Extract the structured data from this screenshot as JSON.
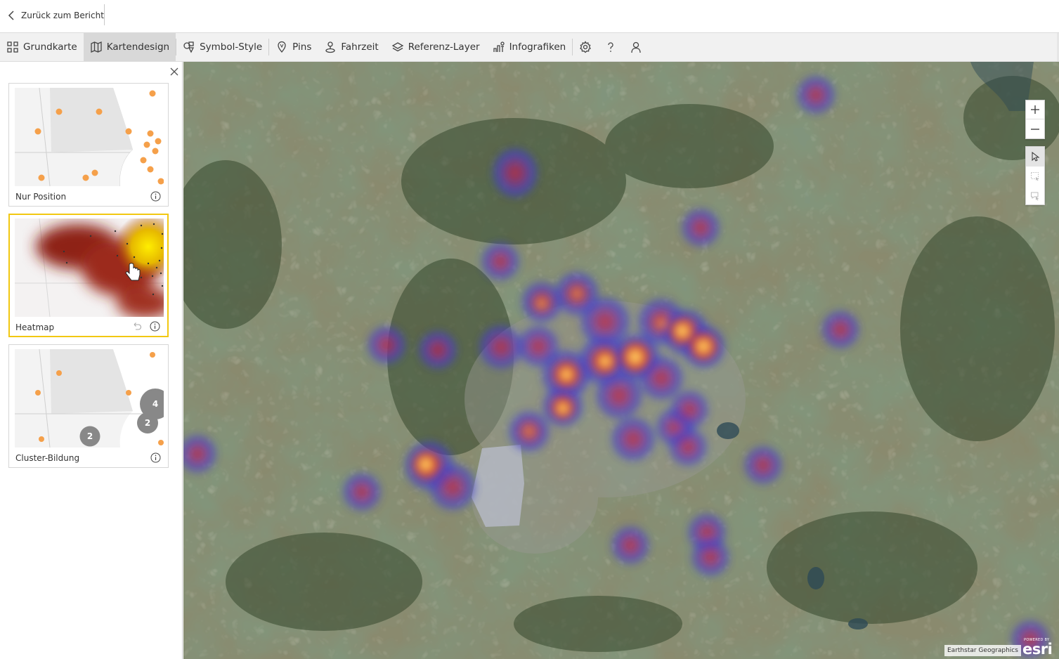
{
  "topbar": {
    "back_label": "Zurück zum Bericht"
  },
  "toolbar": {
    "items": [
      {
        "label": "Grundkarte",
        "icon": "grid-icon"
      },
      {
        "label": "Kartendesign",
        "icon": "map-icon",
        "active": true
      },
      {
        "label": "Symbol-Style",
        "icon": "shapes-icon"
      },
      {
        "label": "Pins",
        "icon": "pin-icon"
      },
      {
        "label": "Fahrzeit",
        "icon": "drive-time-icon"
      },
      {
        "label": "Referenz-Layer",
        "icon": "layers-icon"
      },
      {
        "label": "Infografiken",
        "icon": "infographic-icon"
      }
    ],
    "extra_icons": [
      "gear-icon",
      "help-icon",
      "user-icon"
    ]
  },
  "panel": {
    "cards": [
      {
        "label": "Nur Position",
        "selected": false
      },
      {
        "label": "Heatmap",
        "selected": true
      },
      {
        "label": "Cluster-Bildung",
        "selected": false
      }
    ],
    "cluster_counts": [
      "4",
      "2",
      "2"
    ]
  },
  "map": {
    "attribution": "Earthstar Geographics",
    "esri_powered": "POWERED BY",
    "esri_brand": "esri",
    "colors": {
      "heat_low": "#3a3fd0",
      "heat_mid": "#d0202a",
      "heat_high": "#ffd54a",
      "accent_selected": "#f2c811"
    }
  }
}
